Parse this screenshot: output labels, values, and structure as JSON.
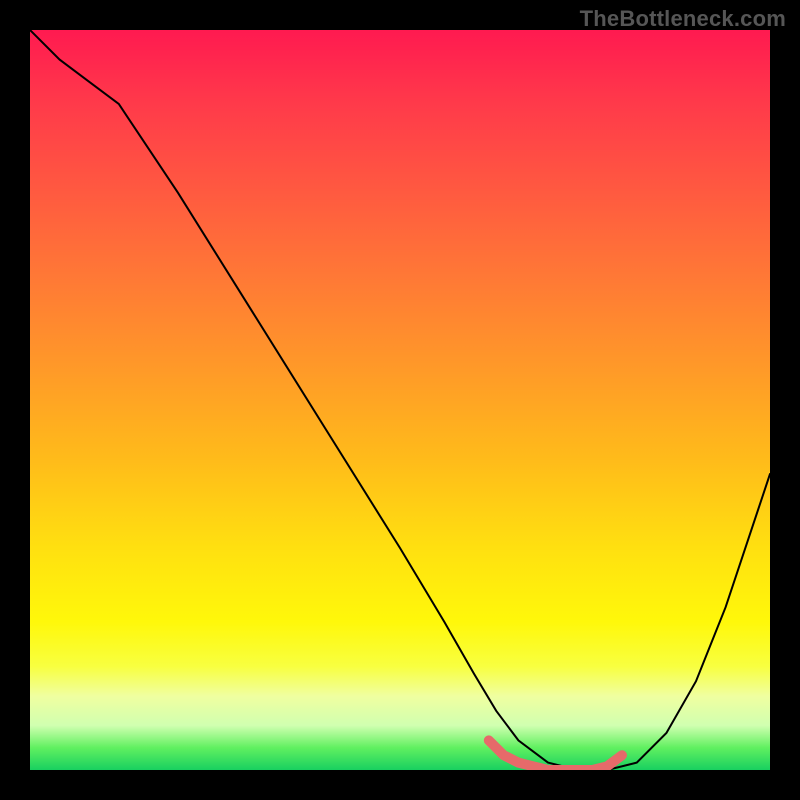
{
  "watermark": "TheBottleneck.com",
  "colors": {
    "curve_main": "#000000",
    "curve_accent": "#e66a6a",
    "background": "#000000",
    "gradient_top": "#ff1a50",
    "gradient_bottom": "#18d060"
  },
  "chart_data": {
    "type": "line",
    "title": "",
    "xlabel": "",
    "ylabel": "",
    "xlim": [
      0,
      100
    ],
    "ylim": [
      0,
      100
    ],
    "grid": false,
    "legend": false,
    "series": [
      {
        "name": "bottleneck_curve",
        "x": [
          0,
          4,
          8,
          12,
          20,
          30,
          40,
          50,
          56,
          60,
          63,
          66,
          70,
          74,
          78,
          82,
          86,
          90,
          94,
          100
        ],
        "y": [
          100,
          96,
          93,
          90,
          78,
          62,
          46,
          30,
          20,
          13,
          8,
          4,
          1,
          0,
          0,
          1,
          5,
          12,
          22,
          40
        ]
      },
      {
        "name": "optimal_zone",
        "x": [
          62,
          64,
          66,
          68,
          70,
          72,
          74,
          76,
          78,
          80
        ],
        "y": [
          4,
          2,
          1,
          0.5,
          0,
          0,
          0,
          0,
          0.5,
          2
        ]
      }
    ],
    "annotations": []
  }
}
